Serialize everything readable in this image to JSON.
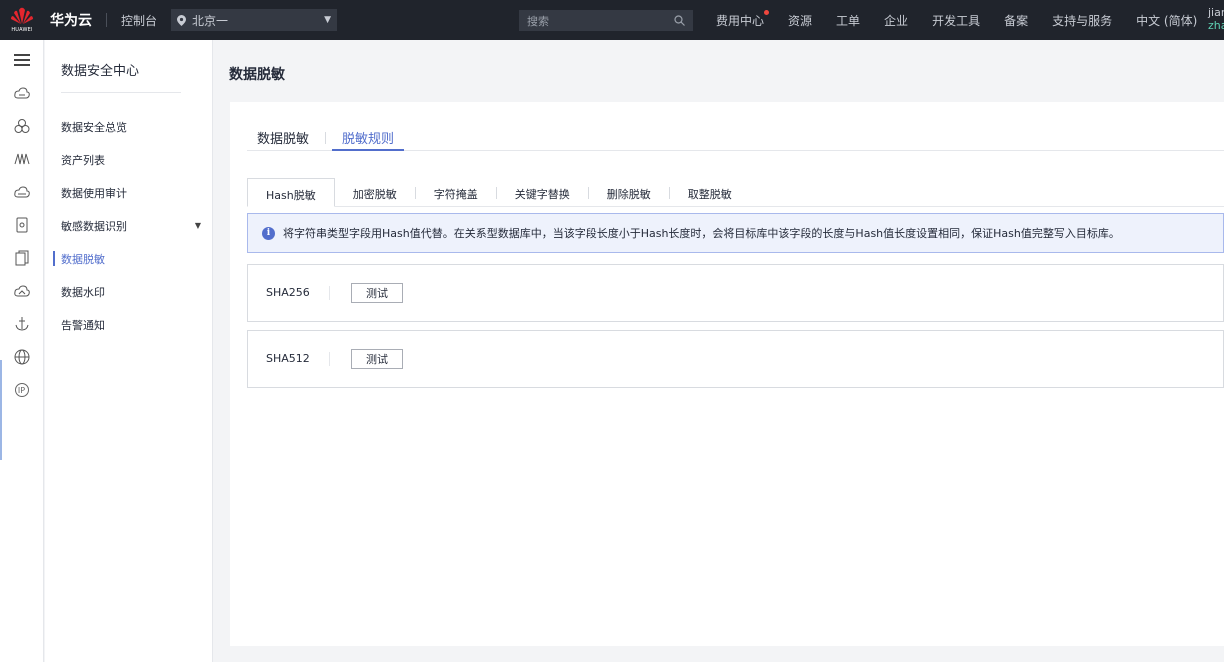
{
  "topbar": {
    "logo_text": "HUAWEI",
    "brand": "华为云",
    "console": "控制台",
    "region": "北京一",
    "search_placeholder": "搜索",
    "nav": [
      "费用中心",
      "资源",
      "工单",
      "企业",
      "开发工具",
      "备案",
      "支持与服务",
      "中文 (简体)"
    ],
    "user_line1": "jian",
    "user_line2": "zha"
  },
  "sidebar": {
    "title": "数据安全中心",
    "items": [
      {
        "label": "数据安全总览"
      },
      {
        "label": "资产列表"
      },
      {
        "label": "数据使用审计"
      },
      {
        "label": "敏感数据识别"
      },
      {
        "label": "数据脱敏"
      },
      {
        "label": "数据水印"
      },
      {
        "label": "告警通知"
      }
    ]
  },
  "main": {
    "title": "数据脱敏",
    "tabs": [
      {
        "label": "数据脱敏"
      },
      {
        "label": "脱敏规则"
      }
    ],
    "subtabs": [
      {
        "label": "Hash脱敏"
      },
      {
        "label": "加密脱敏"
      },
      {
        "label": "字符掩盖"
      },
      {
        "label": "关键字替换"
      },
      {
        "label": "删除脱敏"
      },
      {
        "label": "取整脱敏"
      }
    ],
    "info": "将字符串类型字段用Hash值代替。在关系型数据库中，当该字段长度小于Hash长度时，会将目标库中该字段的长度与Hash值长度设置相同，保证Hash值完整写入目标库。",
    "rows": [
      {
        "name": "SHA256",
        "button": "测试"
      },
      {
        "name": "SHA512",
        "button": "测试"
      }
    ]
  },
  "colors": {
    "accent": "#526ecc",
    "topbar_bg": "#20242c",
    "logo_red": "#e3262e"
  }
}
